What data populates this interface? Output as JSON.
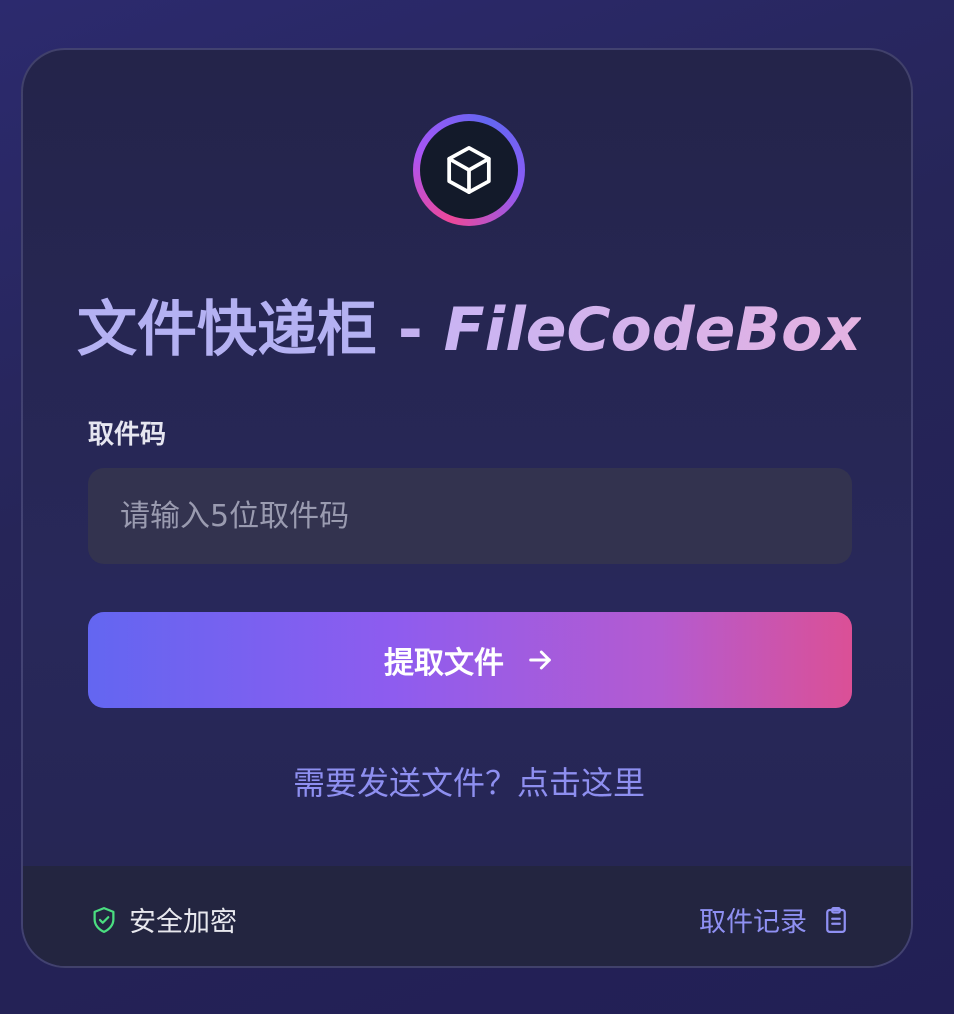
{
  "brand": {
    "title_cn": "文件快递柜",
    "title_sep": " - ",
    "title_en": "FileCodeBox",
    "logo_icon": "cube-icon"
  },
  "form": {
    "label": "取件码",
    "placeholder": "请输入5位取件码",
    "value": "",
    "submit_label": "提取文件",
    "submit_icon": "arrow-right-icon"
  },
  "send_link": "需要发送文件？点击这里",
  "footer": {
    "security_label": "安全加密",
    "security_icon": "shield-check-icon",
    "records_label": "取件记录",
    "records_icon": "clipboard-icon"
  },
  "colors": {
    "accent_start": "#6366f1",
    "accent_mid": "#a855f7",
    "accent_end": "#ec4899",
    "link": "#8e8ff0",
    "security_green": "#4ade80"
  }
}
